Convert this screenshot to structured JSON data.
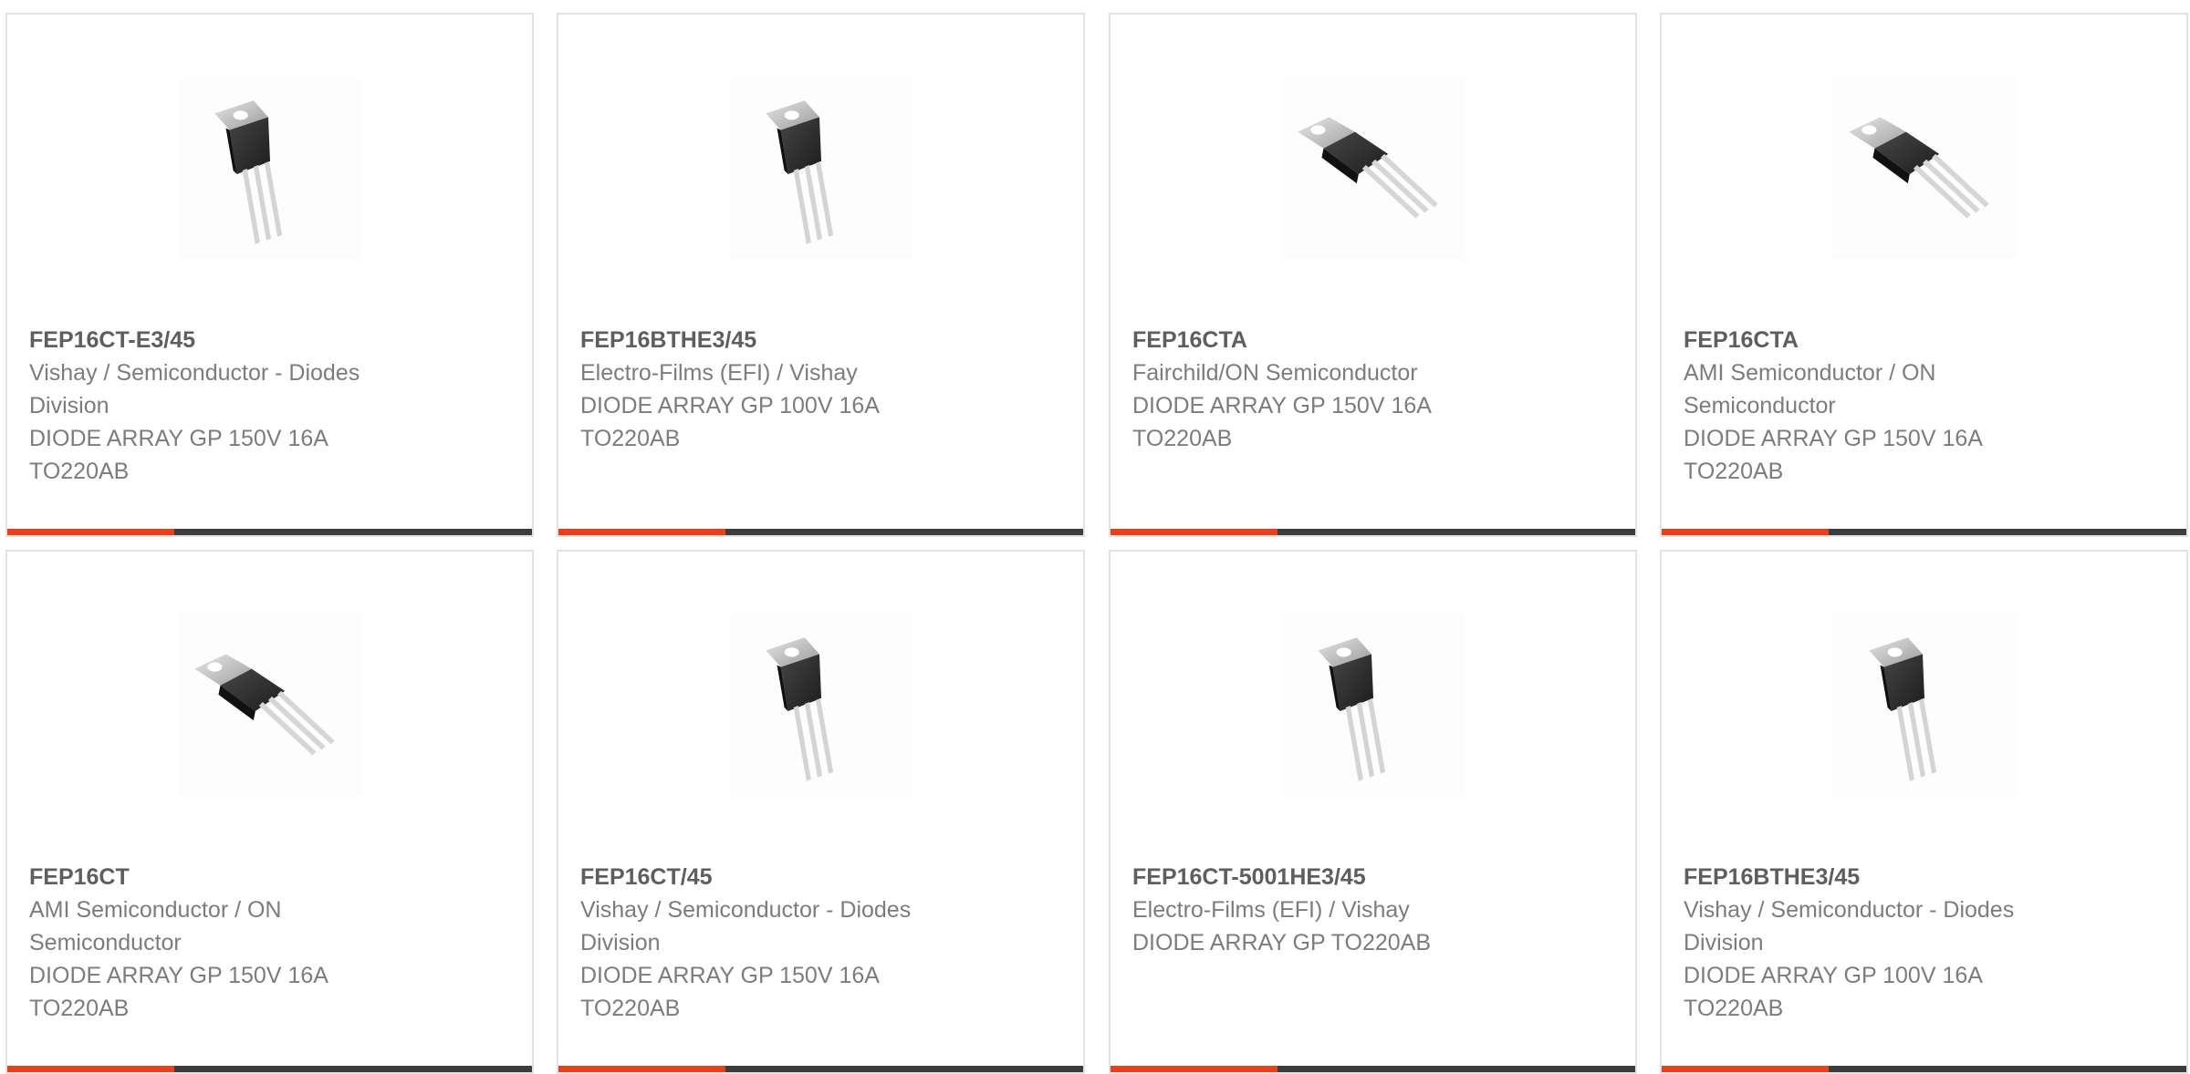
{
  "colors": {
    "accent": "#e8401c",
    "bar_dark": "#3c3c3c",
    "border": "#e2e2e2",
    "part_number": "#5e5e5e",
    "description": "#7c7c7c"
  },
  "products": [
    {
      "image_icon": "to220-transistor-front",
      "part_number": "FEP16CT-E3/45",
      "manufacturer_lines": [
        "Vishay / Semiconductor - Diodes",
        "Division"
      ],
      "description_lines": [
        "DIODE ARRAY GP 150V 16A",
        "TO220AB"
      ]
    },
    {
      "image_icon": "to220-transistor-front",
      "part_number": "FEP16BTHE3/45",
      "manufacturer_lines": [
        "Electro-Films (EFI) / Vishay"
      ],
      "description_lines": [
        "DIODE ARRAY GP 100V 16A",
        "TO220AB"
      ]
    },
    {
      "image_icon": "to220-transistor-angled",
      "part_number": "FEP16CTA",
      "manufacturer_lines": [
        "Fairchild/ON Semiconductor"
      ],
      "description_lines": [
        "DIODE ARRAY GP 150V 16A",
        "TO220AB"
      ]
    },
    {
      "image_icon": "to220-transistor-angled",
      "part_number": "FEP16CTA",
      "manufacturer_lines": [
        "AMI Semiconductor / ON",
        "Semiconductor"
      ],
      "description_lines": [
        "DIODE ARRAY GP 150V 16A",
        "TO220AB"
      ]
    },
    {
      "image_icon": "to220-transistor-angled",
      "part_number": "FEP16CT",
      "manufacturer_lines": [
        "AMI Semiconductor / ON",
        "Semiconductor"
      ],
      "description_lines": [
        "DIODE ARRAY GP 150V 16A",
        "TO220AB"
      ]
    },
    {
      "image_icon": "to220-transistor-front",
      "part_number": "FEP16CT/45",
      "manufacturer_lines": [
        "Vishay / Semiconductor - Diodes",
        "Division"
      ],
      "description_lines": [
        "DIODE ARRAY GP 150V 16A",
        "TO220AB"
      ]
    },
    {
      "image_icon": "to220-transistor-front",
      "part_number": "FEP16CT-5001HE3/45",
      "manufacturer_lines": [
        "Electro-Films (EFI) / Vishay"
      ],
      "description_lines": [
        "DIODE ARRAY GP TO220AB"
      ]
    },
    {
      "image_icon": "to220-transistor-front",
      "part_number": "FEP16BTHE3/45",
      "manufacturer_lines": [
        "Vishay / Semiconductor - Diodes",
        "Division"
      ],
      "description_lines": [
        "DIODE ARRAY GP 100V 16A",
        "TO220AB"
      ]
    }
  ]
}
